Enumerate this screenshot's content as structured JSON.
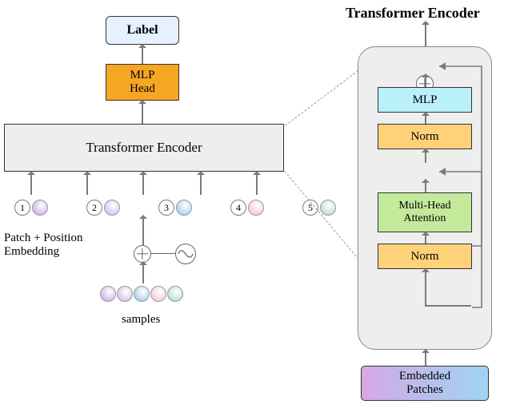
{
  "left": {
    "label": "Label",
    "mlp_head": "MLP\nHead",
    "encoder": "Transformer Encoder",
    "tokens": [
      "1",
      "2",
      "3",
      "4",
      "5"
    ],
    "embedding_caption": "Patch + Position\nEmbedding",
    "samples_caption": "samples"
  },
  "right": {
    "title": "Transformer Encoder",
    "mlp": "MLP",
    "norm": "Norm",
    "attention": "Multi-Head\nAttention",
    "embedded_patches": "Embedded\nPatches"
  },
  "colors": {
    "label_bg": "#e7f0ff",
    "mlp_head_bg": "#f5a623",
    "encoder_bg": "#eeeeee",
    "mlp_bg": "#b9f0fa",
    "norm_bg": "#ffd27a",
    "attention_bg": "#c3e99b"
  }
}
